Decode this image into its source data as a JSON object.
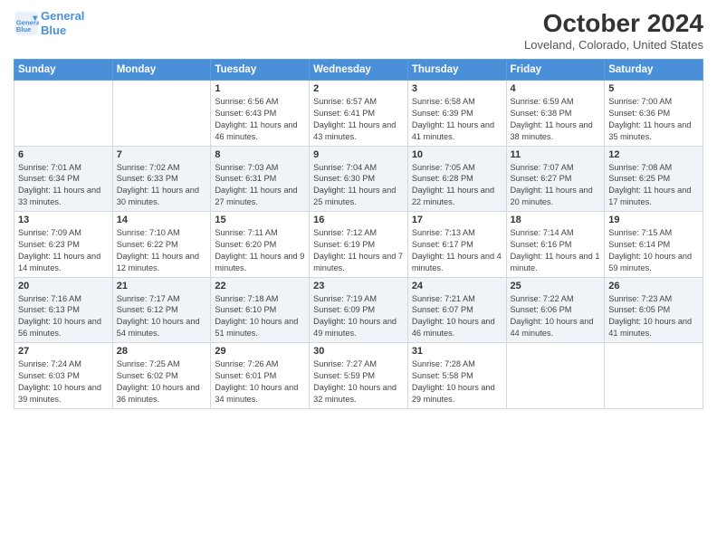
{
  "header": {
    "logo_line1": "General",
    "logo_line2": "Blue",
    "month": "October 2024",
    "location": "Loveland, Colorado, United States"
  },
  "days_of_week": [
    "Sunday",
    "Monday",
    "Tuesday",
    "Wednesday",
    "Thursday",
    "Friday",
    "Saturday"
  ],
  "weeks": [
    [
      {
        "day": "",
        "info": ""
      },
      {
        "day": "",
        "info": ""
      },
      {
        "day": "1",
        "info": "Sunrise: 6:56 AM\nSunset: 6:43 PM\nDaylight: 11 hours and 46 minutes."
      },
      {
        "day": "2",
        "info": "Sunrise: 6:57 AM\nSunset: 6:41 PM\nDaylight: 11 hours and 43 minutes."
      },
      {
        "day": "3",
        "info": "Sunrise: 6:58 AM\nSunset: 6:39 PM\nDaylight: 11 hours and 41 minutes."
      },
      {
        "day": "4",
        "info": "Sunrise: 6:59 AM\nSunset: 6:38 PM\nDaylight: 11 hours and 38 minutes."
      },
      {
        "day": "5",
        "info": "Sunrise: 7:00 AM\nSunset: 6:36 PM\nDaylight: 11 hours and 35 minutes."
      }
    ],
    [
      {
        "day": "6",
        "info": "Sunrise: 7:01 AM\nSunset: 6:34 PM\nDaylight: 11 hours and 33 minutes."
      },
      {
        "day": "7",
        "info": "Sunrise: 7:02 AM\nSunset: 6:33 PM\nDaylight: 11 hours and 30 minutes."
      },
      {
        "day": "8",
        "info": "Sunrise: 7:03 AM\nSunset: 6:31 PM\nDaylight: 11 hours and 27 minutes."
      },
      {
        "day": "9",
        "info": "Sunrise: 7:04 AM\nSunset: 6:30 PM\nDaylight: 11 hours and 25 minutes."
      },
      {
        "day": "10",
        "info": "Sunrise: 7:05 AM\nSunset: 6:28 PM\nDaylight: 11 hours and 22 minutes."
      },
      {
        "day": "11",
        "info": "Sunrise: 7:07 AM\nSunset: 6:27 PM\nDaylight: 11 hours and 20 minutes."
      },
      {
        "day": "12",
        "info": "Sunrise: 7:08 AM\nSunset: 6:25 PM\nDaylight: 11 hours and 17 minutes."
      }
    ],
    [
      {
        "day": "13",
        "info": "Sunrise: 7:09 AM\nSunset: 6:23 PM\nDaylight: 11 hours and 14 minutes."
      },
      {
        "day": "14",
        "info": "Sunrise: 7:10 AM\nSunset: 6:22 PM\nDaylight: 11 hours and 12 minutes."
      },
      {
        "day": "15",
        "info": "Sunrise: 7:11 AM\nSunset: 6:20 PM\nDaylight: 11 hours and 9 minutes."
      },
      {
        "day": "16",
        "info": "Sunrise: 7:12 AM\nSunset: 6:19 PM\nDaylight: 11 hours and 7 minutes."
      },
      {
        "day": "17",
        "info": "Sunrise: 7:13 AM\nSunset: 6:17 PM\nDaylight: 11 hours and 4 minutes."
      },
      {
        "day": "18",
        "info": "Sunrise: 7:14 AM\nSunset: 6:16 PM\nDaylight: 11 hours and 1 minute."
      },
      {
        "day": "19",
        "info": "Sunrise: 7:15 AM\nSunset: 6:14 PM\nDaylight: 10 hours and 59 minutes."
      }
    ],
    [
      {
        "day": "20",
        "info": "Sunrise: 7:16 AM\nSunset: 6:13 PM\nDaylight: 10 hours and 56 minutes."
      },
      {
        "day": "21",
        "info": "Sunrise: 7:17 AM\nSunset: 6:12 PM\nDaylight: 10 hours and 54 minutes."
      },
      {
        "day": "22",
        "info": "Sunrise: 7:18 AM\nSunset: 6:10 PM\nDaylight: 10 hours and 51 minutes."
      },
      {
        "day": "23",
        "info": "Sunrise: 7:19 AM\nSunset: 6:09 PM\nDaylight: 10 hours and 49 minutes."
      },
      {
        "day": "24",
        "info": "Sunrise: 7:21 AM\nSunset: 6:07 PM\nDaylight: 10 hours and 46 minutes."
      },
      {
        "day": "25",
        "info": "Sunrise: 7:22 AM\nSunset: 6:06 PM\nDaylight: 10 hours and 44 minutes."
      },
      {
        "day": "26",
        "info": "Sunrise: 7:23 AM\nSunset: 6:05 PM\nDaylight: 10 hours and 41 minutes."
      }
    ],
    [
      {
        "day": "27",
        "info": "Sunrise: 7:24 AM\nSunset: 6:03 PM\nDaylight: 10 hours and 39 minutes."
      },
      {
        "day": "28",
        "info": "Sunrise: 7:25 AM\nSunset: 6:02 PM\nDaylight: 10 hours and 36 minutes."
      },
      {
        "day": "29",
        "info": "Sunrise: 7:26 AM\nSunset: 6:01 PM\nDaylight: 10 hours and 34 minutes."
      },
      {
        "day": "30",
        "info": "Sunrise: 7:27 AM\nSunset: 5:59 PM\nDaylight: 10 hours and 32 minutes."
      },
      {
        "day": "31",
        "info": "Sunrise: 7:28 AM\nSunset: 5:58 PM\nDaylight: 10 hours and 29 minutes."
      },
      {
        "day": "",
        "info": ""
      },
      {
        "day": "",
        "info": ""
      }
    ]
  ]
}
